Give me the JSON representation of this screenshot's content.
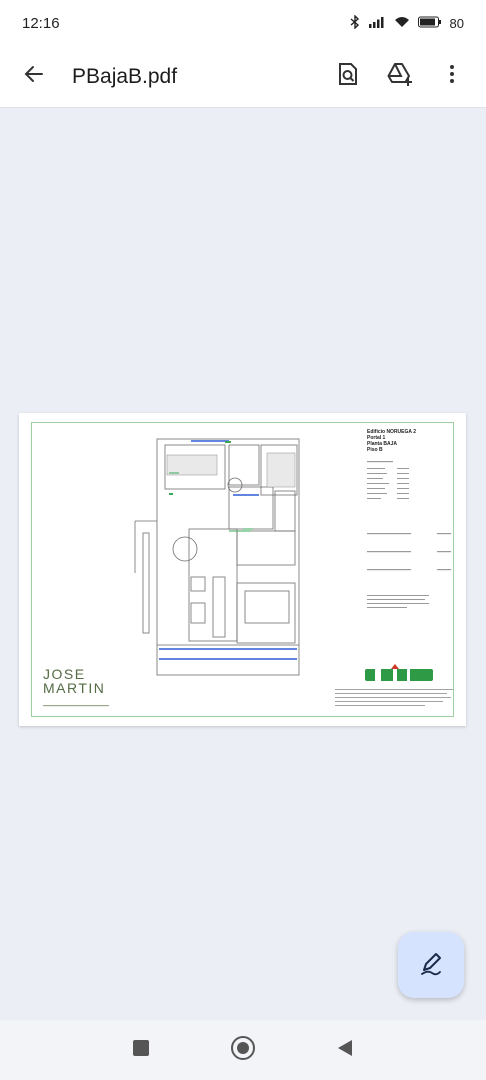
{
  "status_bar": {
    "time": "12:16",
    "battery": "80"
  },
  "app_bar": {
    "title": "PBajaB.pdf",
    "icons": [
      "back-arrow-icon",
      "search-document-icon",
      "drive-add-icon",
      "more-vert-icon"
    ]
  },
  "document": {
    "info": {
      "line1": "Edificio NORUEGA 2",
      "line2": "Portal 1",
      "line3": "Planta BAJA",
      "line4": "Piso B"
    },
    "logo": {
      "line1": "JOSE",
      "line2": "MARTIN"
    }
  },
  "fab": {
    "icon": "edit-pen-icon"
  },
  "nav_bar": {
    "icons": [
      "recents-square-icon",
      "home-circle-icon",
      "back-triangle-icon"
    ]
  },
  "colors": {
    "background": "#eceef6",
    "fab": "#d6e3ff",
    "plan_blue": "#2f5fd6",
    "plan_green": "#3aa657"
  }
}
